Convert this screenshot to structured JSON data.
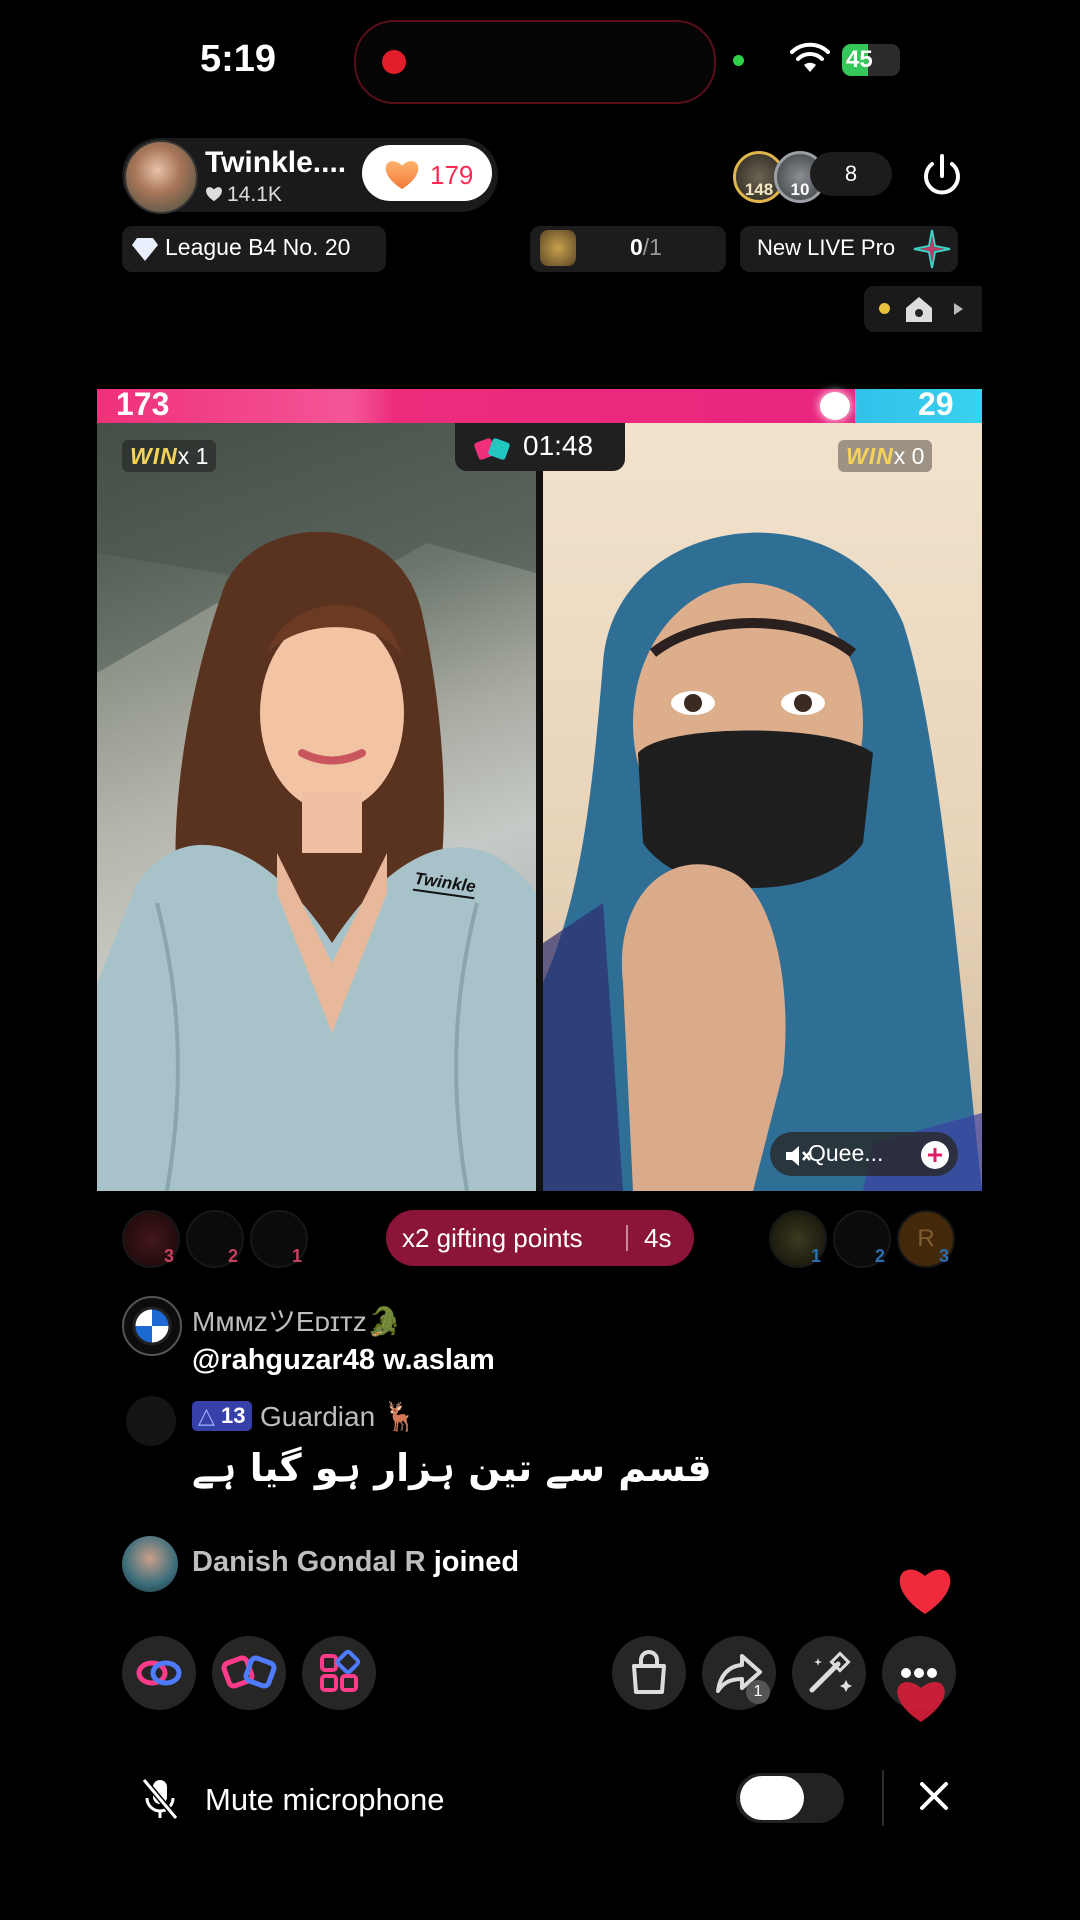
{
  "status_bar": {
    "time": "5:19",
    "battery": "45",
    "battery_level": 0.45,
    "recording": true
  },
  "host": {
    "name": "Twinkle....",
    "likes": "14.1K",
    "follow_count": "179"
  },
  "viewers": {
    "avatars": [
      {
        "badge": "148"
      },
      {
        "badge": "10"
      }
    ],
    "count": "8"
  },
  "league": {
    "label": "League B4 No. 20"
  },
  "gift_goal": {
    "current": "0",
    "total": "/1"
  },
  "new_live": {
    "label": "New LIVE Pro"
  },
  "battle": {
    "score_left": "173",
    "score_right": "29",
    "left_share": 0.856,
    "timer": "01:48",
    "left": {
      "win_word": "WIN",
      "win_count": "x 1",
      "watermark": "Twinkle"
    },
    "right": {
      "win_word": "WIN",
      "win_count": "x 0",
      "name": "Quee..."
    }
  },
  "gifting": {
    "label": "x2 gifting points",
    "seconds": "4s",
    "left_ranks": [
      "3",
      "2",
      "1"
    ],
    "right_ranks": [
      "1",
      "2",
      "3"
    ],
    "right_initial": "R"
  },
  "chat": [
    {
      "user": "MᴍᴍzツEᴅɪᴛᴢ🐊",
      "message": "@rahguzar48 w.aslam"
    },
    {
      "level": "13",
      "user": "Guardian 🦌",
      "message": "قسم سے تین ہزار ہو گیا ہے"
    },
    {
      "user": "Danish Gondal R",
      "action": "joined"
    }
  ],
  "actions": {
    "share_count": "1"
  },
  "bottom": {
    "mute_label": "Mute microphone"
  },
  "colors": {
    "accent": "#fe2c55",
    "battle_red": "#ee2a83",
    "battle_blue": "#3ad1ef",
    "win_gold": "#f5d35a"
  }
}
